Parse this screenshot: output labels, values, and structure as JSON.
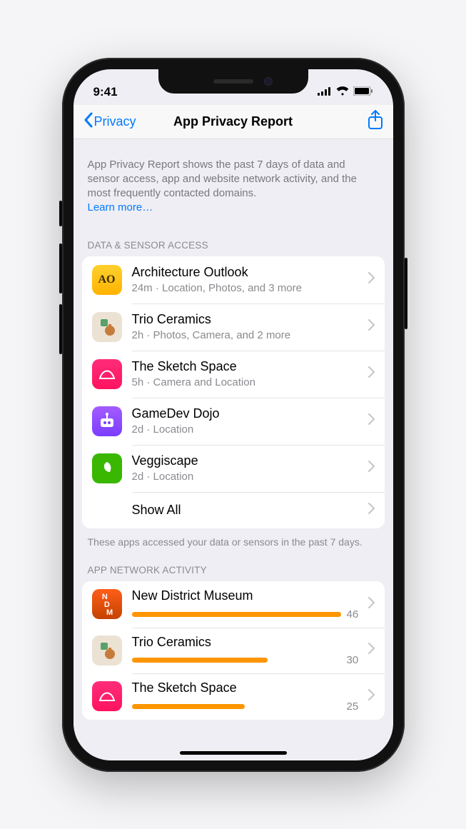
{
  "status": {
    "time": "9:41"
  },
  "nav": {
    "back_label": "Privacy",
    "title": "App Privacy Report"
  },
  "intro": {
    "text": "App Privacy Report shows the past 7 days of data and sensor access, app and website network activity, and the most frequently contacted domains.",
    "learn_more": "Learn more…"
  },
  "data_sensor": {
    "header": "DATA & SENSOR ACCESS",
    "footer": "These apps accessed your data or sensors in the past 7 days.",
    "show_all": "Show All",
    "items": [
      {
        "name": "Architecture Outlook",
        "detail": "24m · Location, Photos, and 3 more",
        "icon_text": "AO",
        "icon_class": "ic-ao"
      },
      {
        "name": "Trio Ceramics",
        "detail": "2h · Photos, Camera, and 2 more",
        "icon_text": "",
        "icon_class": "ic-trio"
      },
      {
        "name": "The Sketch Space",
        "detail": "5h · Camera and Location",
        "icon_text": "",
        "icon_class": "ic-sketch"
      },
      {
        "name": "GameDev Dojo",
        "detail": "2d · Location",
        "icon_text": "",
        "icon_class": "ic-game"
      },
      {
        "name": "Veggiscape",
        "detail": "2d · Location",
        "icon_text": "",
        "icon_class": "ic-veg"
      }
    ]
  },
  "network": {
    "header": "APP NETWORK ACTIVITY",
    "max": 46,
    "items": [
      {
        "name": "New District Museum",
        "value": 46,
        "icon_class": "ic-ndm"
      },
      {
        "name": "Trio Ceramics",
        "value": 30,
        "icon_class": "ic-trio"
      },
      {
        "name": "The Sketch Space",
        "value": 25,
        "icon_class": "ic-sketch"
      }
    ]
  },
  "colors": {
    "accent": "#007aff",
    "bar": "#ff9500"
  }
}
